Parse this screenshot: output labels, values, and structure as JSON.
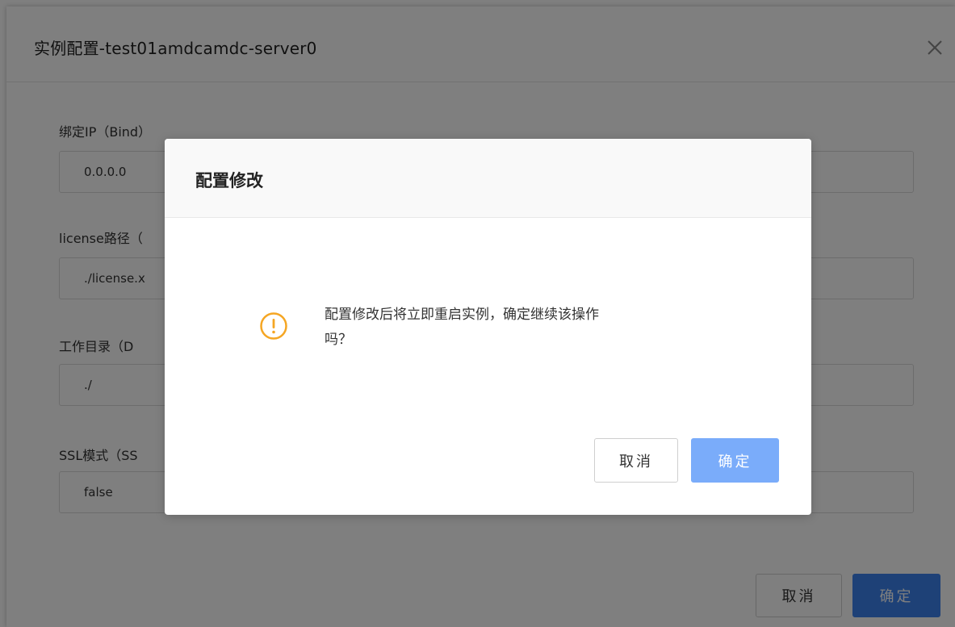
{
  "background_dialog": {
    "title": "实例配置-test01amdcamdc-server0",
    "fields": [
      {
        "label": "绑定IP（Bind）",
        "value": "0.0.0.0"
      },
      {
        "label": "license路径（",
        "value": "./license.x"
      },
      {
        "label": "工作目录（D",
        "value": "./"
      },
      {
        "label": "SSL模式（SS",
        "value": "false"
      }
    ],
    "cancel_label": "取消",
    "confirm_label": "确定"
  },
  "confirm_modal": {
    "title": "配置修改",
    "message_line1": "配置修改后将立即重启实例，确定继续该操作",
    "message_line2": "吗？",
    "cancel_label": "取消",
    "confirm_label": "确定",
    "icon": "warning-circle-icon"
  },
  "colors": {
    "primary": "#3c83ef",
    "primary_light": "#7aacfa",
    "warning": "#f5a623"
  }
}
